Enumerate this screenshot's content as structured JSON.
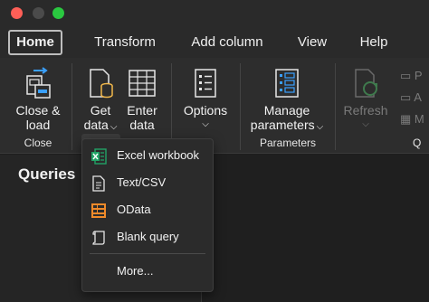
{
  "window": {
    "controls": [
      "close",
      "minimize",
      "zoom"
    ]
  },
  "tabs": [
    {
      "label": "Home",
      "active": true
    },
    {
      "label": "Transform",
      "active": false
    },
    {
      "label": "Add column",
      "active": false
    },
    {
      "label": "View",
      "active": false
    },
    {
      "label": "Help",
      "active": false
    }
  ],
  "ribbon": {
    "close_load": {
      "line1": "Close &",
      "line2": "load"
    },
    "get_data": {
      "line1": "Get",
      "line2": "data",
      "chevron": "⌵"
    },
    "enter_data": {
      "line1": "Enter",
      "line2": "data"
    },
    "options": {
      "line1": "Options",
      "chevron": "⌵"
    },
    "manage_params": {
      "line1": "Manage",
      "line2": "parameters",
      "chevron": "⌵"
    },
    "refresh": {
      "line1": "Refresh",
      "chevron": "⌵"
    },
    "cut_items": [
      "P",
      "A",
      "M"
    ],
    "groups": {
      "close": "Close",
      "options_partial": "ns",
      "parameters": "Parameters",
      "query_partial": "Q"
    }
  },
  "queries_pane": {
    "title": "Queries"
  },
  "get_data_menu": {
    "items": [
      {
        "label": "Excel workbook",
        "icon": "excel-icon"
      },
      {
        "label": "Text/CSV",
        "icon": "document-icon"
      },
      {
        "label": "OData",
        "icon": "odata-icon"
      },
      {
        "label": "Blank query",
        "icon": "scroll-icon"
      }
    ],
    "more": "More..."
  },
  "colors": {
    "excel_green": "#21a366",
    "odata_orange": "#f08a2a",
    "traffic_red": "#fe5f57",
    "traffic_green": "#2ac840"
  }
}
